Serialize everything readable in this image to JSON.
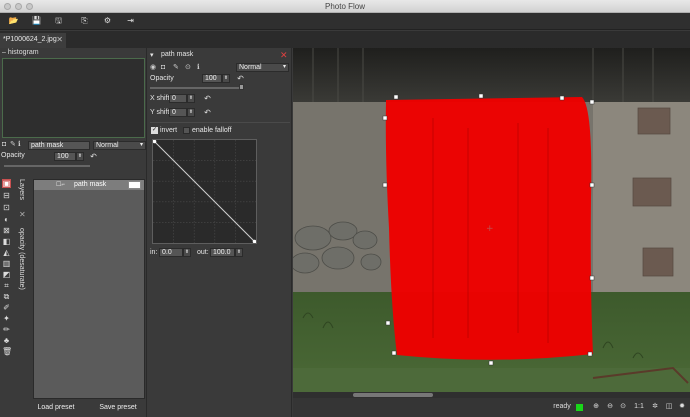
{
  "window": {
    "title": "Photo Flow"
  },
  "toolbar": {
    "buttons": [
      {
        "name": "open-icon",
        "glyph": "📂"
      },
      {
        "name": "save-icon",
        "glyph": "💾"
      },
      {
        "name": "save-as-icon",
        "glyph": "🖫"
      },
      {
        "name": "export-icon",
        "glyph": "⎘"
      },
      {
        "name": "settings-icon",
        "glyph": "⚙"
      },
      {
        "name": "exit-icon",
        "glyph": "⇥"
      }
    ]
  },
  "tab": {
    "label": "*P1000624_2.jpg",
    "close": "✕"
  },
  "histogram": {
    "title": "histogram",
    "collapse": "–"
  },
  "layer_controls": {
    "name_value": "path mask",
    "blend_mode": "Normal",
    "opacity_label": "Opacity",
    "opacity_value": "100"
  },
  "vertical_tabs": {
    "layers": "Layers",
    "opacity": "opacity (desaturate)"
  },
  "layers": {
    "items": [
      {
        "label": "path mask",
        "visible_glyph": "☐⌐"
      }
    ]
  },
  "presets": {
    "load": "Load preset",
    "save": "Save preset"
  },
  "tool_panel": {
    "title": "path mask",
    "blend_mode": "Normal",
    "opacity_label": "Opacity",
    "opacity_value": "100",
    "x_shift_label": "X shift",
    "x_shift_value": "0",
    "y_shift_label": "Y shift",
    "y_shift_value": "0",
    "invert_label": "invert",
    "invert_checked": true,
    "falloff_label": "enable falloff",
    "falloff_checked": false,
    "in_label": "in:",
    "in_value": "0.0",
    "out_label": "out:",
    "out_value": "100.0"
  },
  "status": {
    "text": "ready",
    "indicator_color": "#19d619",
    "zoom_one_to_one": "1:1"
  },
  "colors": {
    "mask": "#ee0000",
    "accent": "#4b6b4b"
  }
}
